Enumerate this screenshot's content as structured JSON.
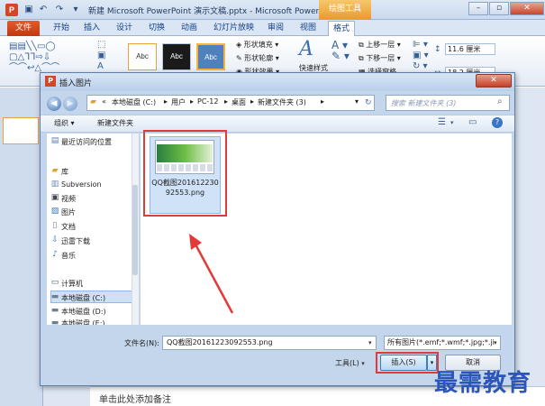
{
  "app": {
    "logo": "P",
    "title": "新建 Microsoft PowerPoint 演示文稿.pptx - Microsoft PowerPoint",
    "context_tab_header": "绘图工具",
    "window_controls": [
      "–",
      "▫",
      "✕"
    ],
    "qat_icons": [
      "save-icon",
      "undo-icon",
      "redo-icon",
      "customize-icon"
    ]
  },
  "ribbon": {
    "tabs": [
      "文件",
      "开始",
      "插入",
      "设计",
      "切换",
      "动画",
      "幻灯片放映",
      "审阅",
      "视图",
      "格式"
    ],
    "active_tab": "格式",
    "style_buttons": [
      "Abc",
      "Abc",
      "Abc"
    ],
    "shape_fill": "形状填充",
    "shape_outline": "形状轮廓",
    "shape_effects": "形状效果",
    "quick_styles": "快速样式",
    "bring_forward": "上移一层",
    "send_backward": "下移一层",
    "selection_pane": "选择窗格",
    "height_value": "11.6 厘米",
    "width_value": "18.2 厘米"
  },
  "dialog": {
    "title": "插入图片",
    "close": "✕",
    "breadcrumb": [
      "«",
      "本地磁盘 (C:)",
      "用户",
      "PC-12",
      "桌面",
      "新建文件夹 (3)"
    ],
    "search_placeholder": "搜索 新建文件夹 (3)",
    "organize": "组织 ▾",
    "new_folder": "新建文件夹",
    "nav_items": [
      {
        "icon": "recent-places-icon",
        "label": "最近访问的位置"
      },
      {
        "icon": "library-icon",
        "label": "库"
      },
      {
        "icon": "subversion-icon",
        "label": "Subversion"
      },
      {
        "icon": "video-icon",
        "label": "视频"
      },
      {
        "icon": "picture-icon",
        "label": "图片"
      },
      {
        "icon": "document-icon",
        "label": "文档"
      },
      {
        "icon": "download-icon",
        "label": "迅雷下载"
      },
      {
        "icon": "music-icon",
        "label": "音乐"
      },
      {
        "icon": "computer-icon",
        "label": "计算机"
      },
      {
        "icon": "drive-icon",
        "label": "本地磁盘 (C:)"
      },
      {
        "icon": "drive-icon",
        "label": "本地磁盘 (D:)"
      },
      {
        "icon": "drive-icon",
        "label": "本地磁盘 (E:)"
      }
    ],
    "file": {
      "name": "QQ截图20161223092553.png"
    },
    "filename_label": "文件名(N):",
    "filename_value": "QQ截图20161223092553.png",
    "filetype_value": "所有图片(*.emf;*.wmf;*.jpg;*.ji",
    "tools": "工具(L)",
    "insert": "插入(S)",
    "cancel": "取消"
  },
  "notes": {
    "placeholder": "单击此处添加备注"
  },
  "watermark": "最需教育",
  "colors": {
    "highlight": "#e23a3a",
    "file_tab": "#c0390f",
    "context_tab": "#e99a2c"
  }
}
